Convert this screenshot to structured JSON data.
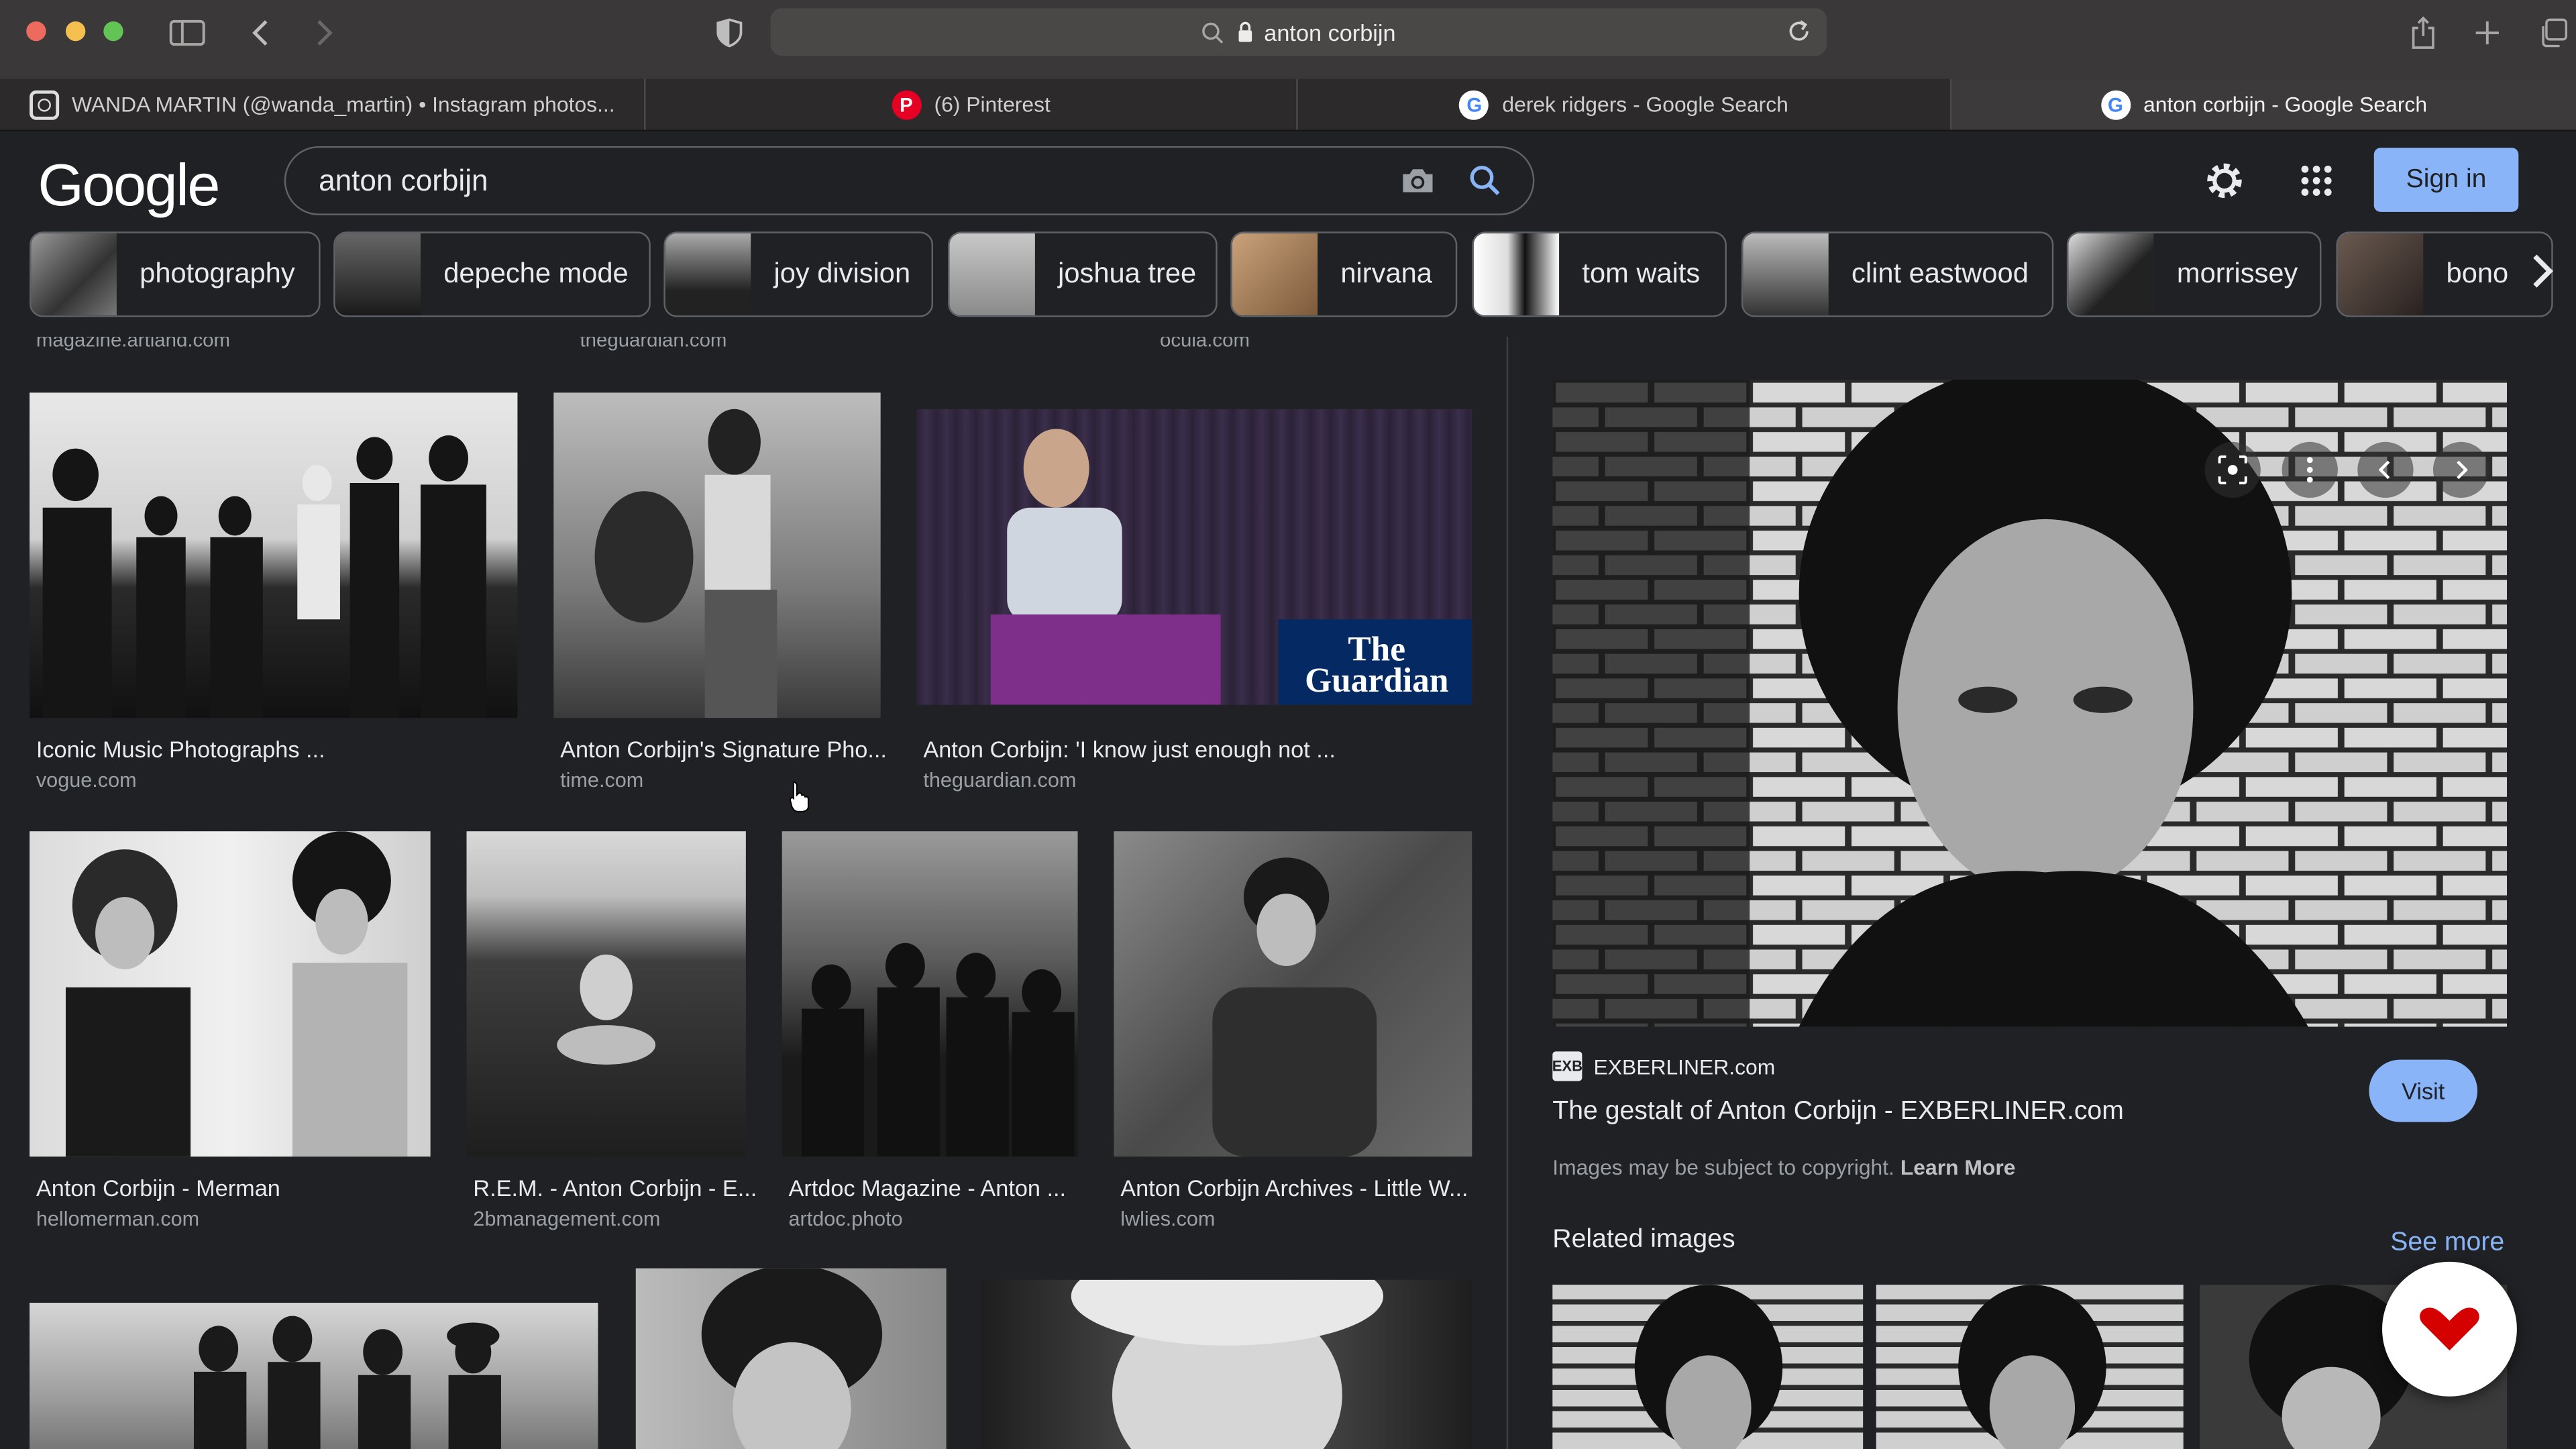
{
  "browser": {
    "url": "anton corbijn",
    "tabs": [
      {
        "label": "WANDA MARTIN (@wanda_martin) • Instagram photos...",
        "favicon": "instagram-icon"
      },
      {
        "label": "(6) Pinterest",
        "favicon": "pinterest-icon"
      },
      {
        "label": "derek ridgers - Google Search",
        "favicon": "google-icon"
      },
      {
        "label": "anton corbijn - Google Search",
        "favicon": "google-icon",
        "active": true
      }
    ]
  },
  "google": {
    "logo": "Google",
    "query": "anton corbijn",
    "sign_in": "Sign in",
    "chips": [
      "photography",
      "depeche mode",
      "joy division",
      "joshua tree",
      "nirvana",
      "tom waits",
      "clint eastwood",
      "morrissey",
      "bono"
    ]
  },
  "results": {
    "top_sources": [
      "magazine.artland.com",
      "theguardian.com",
      "ocula.com"
    ],
    "items": [
      {
        "title": "Iconic Music Photographs ...",
        "source": "vogue.com"
      },
      {
        "title": "Anton Corbijn's Signature Pho...",
        "source": "time.com"
      },
      {
        "title": "Anton Corbijn: 'I know just enough not ...",
        "source": "theguardian.com",
        "watermark": "The Guardian"
      },
      {
        "title": "Anton Corbijn - Merman",
        "source": "hellomerman.com"
      },
      {
        "title": "R.E.M. - Anton Corbijn - E...",
        "source": "2bmanagement.com"
      },
      {
        "title": "Artdoc Magazine - Anton ...",
        "source": "artdoc.photo"
      },
      {
        "title": "Anton Corbijn Archives - Little W...",
        "source": "lwlies.com"
      }
    ]
  },
  "preview": {
    "source": "EXBERLINER.com",
    "source_logo": "EXB",
    "title": "The gestalt of Anton Corbijn - EXBERLINER.com",
    "visit": "Visit",
    "copyright": "Images may be subject to copyright.",
    "learn_more": "Learn More",
    "related_heading": "Related images",
    "see_more": "See more"
  }
}
